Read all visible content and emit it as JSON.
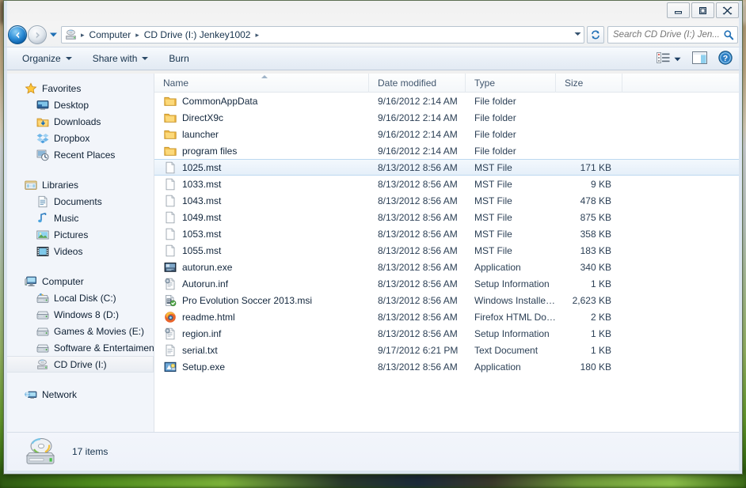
{
  "window": {
    "controls": {
      "minimize_label": "Minimize",
      "maximize_label": "Maximize",
      "close_label": "Close"
    }
  },
  "address_bar": {
    "back_label": "Back",
    "forward_label": "Forward",
    "recent_label": "Recent pages",
    "refresh_label": "Refresh",
    "breadcrumbs": [
      {
        "label": "Computer"
      },
      {
        "label": "CD Drive (I:) Jenkey1002"
      }
    ],
    "separator": "▸"
  },
  "search": {
    "placeholder": "Search CD Drive (I:) Jen...",
    "value": "",
    "icon": "search-icon"
  },
  "command_bar": {
    "items": [
      {
        "label": "Organize",
        "has_caret": true
      },
      {
        "label": "Share with",
        "has_caret": true
      },
      {
        "label": "Burn",
        "has_caret": false
      }
    ],
    "view_button_label": "Change your view",
    "preview_button_label": "Show the preview pane",
    "help_button_label": "Get help"
  },
  "nav_pane": {
    "groups": [
      {
        "header": {
          "label": "Favorites",
          "icon": "star-icon"
        },
        "items": [
          {
            "label": "Desktop",
            "icon": "desktop-icon"
          },
          {
            "label": "Downloads",
            "icon": "downloads-icon"
          },
          {
            "label": "Dropbox",
            "icon": "dropbox-icon"
          },
          {
            "label": "Recent Places",
            "icon": "recent-places-icon"
          }
        ]
      },
      {
        "header": {
          "label": "Libraries",
          "icon": "libraries-icon"
        },
        "items": [
          {
            "label": "Documents",
            "icon": "documents-icon"
          },
          {
            "label": "Music",
            "icon": "music-icon"
          },
          {
            "label": "Pictures",
            "icon": "pictures-icon"
          },
          {
            "label": "Videos",
            "icon": "videos-icon"
          }
        ]
      },
      {
        "header": {
          "label": "Computer",
          "icon": "computer-icon"
        },
        "items": [
          {
            "label": "Local Disk (C:)",
            "icon": "system-drive-icon",
            "selected": false
          },
          {
            "label": "Windows 8 (D:)",
            "icon": "drive-icon",
            "selected": false
          },
          {
            "label": "Games & Movies (E:)",
            "icon": "drive-icon",
            "selected": false
          },
          {
            "label": "Software & Entertaiment",
            "icon": "drive-icon",
            "selected": false
          },
          {
            "label": "CD Drive (I:)",
            "icon": "cd-drive-icon",
            "selected": true
          }
        ]
      },
      {
        "header": {
          "label": "Network",
          "icon": "network-icon"
        },
        "items": []
      }
    ]
  },
  "file_list": {
    "columns": [
      {
        "key": "name",
        "label": "Name",
        "sorted": true,
        "sort_dir": "asc"
      },
      {
        "key": "date",
        "label": "Date modified",
        "sorted": false
      },
      {
        "key": "type",
        "label": "Type",
        "sorted": false
      },
      {
        "key": "size",
        "label": "Size",
        "sorted": false
      }
    ],
    "rows": [
      {
        "name": "CommonAppData",
        "date": "9/16/2012 2:14 AM",
        "type": "File folder",
        "size": "",
        "icon": "folder-icon",
        "selected": false
      },
      {
        "name": "DirectX9c",
        "date": "9/16/2012 2:14 AM",
        "type": "File folder",
        "size": "",
        "icon": "folder-icon",
        "selected": false
      },
      {
        "name": "launcher",
        "date": "9/16/2012 2:14 AM",
        "type": "File folder",
        "size": "",
        "icon": "folder-icon",
        "selected": false
      },
      {
        "name": "program files",
        "date": "9/16/2012 2:14 AM",
        "type": "File folder",
        "size": "",
        "icon": "folder-icon",
        "selected": false
      },
      {
        "name": "1025.mst",
        "date": "8/13/2012 8:56 AM",
        "type": "MST File",
        "size": "171 KB",
        "icon": "blank-file-icon",
        "selected": true
      },
      {
        "name": "1033.mst",
        "date": "8/13/2012 8:56 AM",
        "type": "MST File",
        "size": "9 KB",
        "icon": "blank-file-icon",
        "selected": false
      },
      {
        "name": "1043.mst",
        "date": "8/13/2012 8:56 AM",
        "type": "MST File",
        "size": "478 KB",
        "icon": "blank-file-icon",
        "selected": false
      },
      {
        "name": "1049.mst",
        "date": "8/13/2012 8:56 AM",
        "type": "MST File",
        "size": "875 KB",
        "icon": "blank-file-icon",
        "selected": false
      },
      {
        "name": "1053.mst",
        "date": "8/13/2012 8:56 AM",
        "type": "MST File",
        "size": "358 KB",
        "icon": "blank-file-icon",
        "selected": false
      },
      {
        "name": "1055.mst",
        "date": "8/13/2012 8:56 AM",
        "type": "MST File",
        "size": "183 KB",
        "icon": "blank-file-icon",
        "selected": false
      },
      {
        "name": "autorun.exe",
        "date": "8/13/2012 8:56 AM",
        "type": "Application",
        "size": "340 KB",
        "icon": "exe-icon",
        "selected": false
      },
      {
        "name": "Autorun.inf",
        "date": "8/13/2012 8:56 AM",
        "type": "Setup Information",
        "size": "1 KB",
        "icon": "inf-icon",
        "selected": false
      },
      {
        "name": "Pro Evolution Soccer 2013.msi",
        "date": "8/13/2012 8:56 AM",
        "type": "Windows Installer ...",
        "size": "2,623 KB",
        "icon": "msi-icon",
        "selected": false
      },
      {
        "name": "readme.html",
        "date": "8/13/2012 8:56 AM",
        "type": "Firefox HTML Doc...",
        "size": "2 KB",
        "icon": "firefox-icon",
        "selected": false
      },
      {
        "name": "region.inf",
        "date": "8/13/2012 8:56 AM",
        "type": "Setup Information",
        "size": "1 KB",
        "icon": "inf-icon",
        "selected": false
      },
      {
        "name": "serial.txt",
        "date": "9/17/2012 6:21 PM",
        "type": "Text Document",
        "size": "1 KB",
        "icon": "txt-icon",
        "selected": false
      },
      {
        "name": "Setup.exe",
        "date": "8/13/2012 8:56 AM",
        "type": "Application",
        "size": "180 KB",
        "icon": "setup-exe-icon",
        "selected": false
      }
    ]
  },
  "status_bar": {
    "item_count_text": "17 items",
    "icon": "cd-drive-large-icon"
  },
  "colors": {
    "selection_fill": "#e5eff9",
    "selection_border": "#bcd8f0",
    "nav_pane_bg": "#f2f5fa",
    "header_text": "#41566e",
    "accent_blue": "#2f8fd8"
  }
}
